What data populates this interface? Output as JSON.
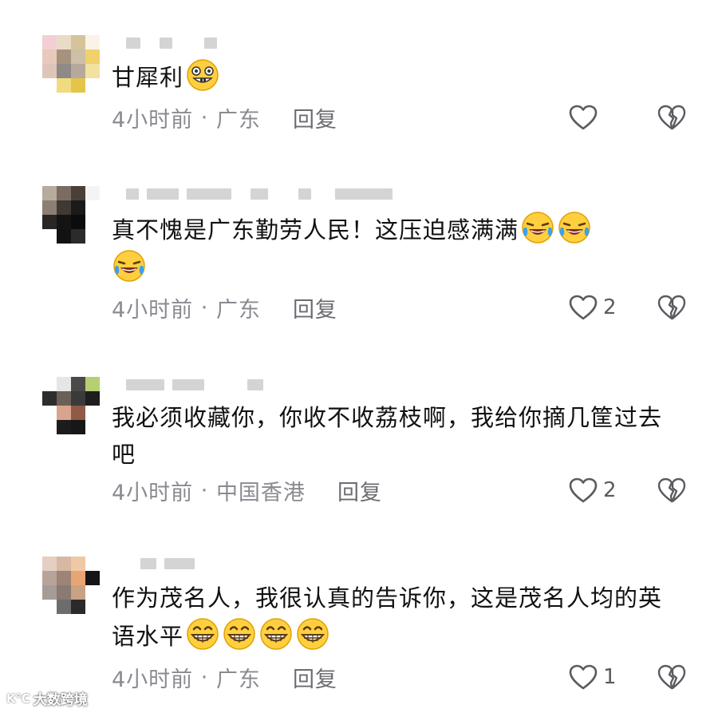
{
  "comments": [
    {
      "text": "甘犀利",
      "emojis": [
        "grin-face"
      ],
      "time": "4小时前",
      "location": "广东",
      "reply_label": "回复",
      "like_count": "",
      "avatar_colors": [
        "#f2cfd5",
        "#e9dcc6",
        "#d6c29b",
        "#fbf3e8",
        "#e8c9bb",
        "#a7927f",
        "#cdbfa8",
        "#f0d16b",
        "#dfc5b8",
        "#8f8a87",
        "#b6a89a",
        "#f3e1a0",
        "#ffffff",
        "#f0dc7e",
        "#e5c44a",
        "#ffffff"
      ]
    },
    {
      "text": "真不愧是广东勤劳人民！这压迫感满满",
      "emojis": [
        "laughing-crying-face",
        "laughing-crying-face",
        "laughing-crying-face"
      ],
      "time": "4小时前",
      "location": "广东",
      "reply_label": "回复",
      "like_count": "2",
      "avatar_colors": [
        "#b7ab9c",
        "#7a6c62",
        "#4b4038",
        "#f4f4f4",
        "#8c7f74",
        "#3f3833",
        "#1c1a19",
        "#ffffff",
        "#2a2624",
        "#141414",
        "#0c0c0c",
        "#ffffff",
        "#ffffff",
        "#121212",
        "#2b2b2b",
        "#ffffff"
      ]
    },
    {
      "text": "我必须收藏你，你收不收荔枝啊，我给你摘几筐过去吧",
      "emojis": [],
      "time": "4小时前",
      "location": "中国香港",
      "reply_label": "回复",
      "like_count": "2",
      "avatar_colors": [
        "#ffffff",
        "#e6e6e6",
        "#4a4a4a",
        "#b6cf72",
        "#2d2d2d",
        "#6b6056",
        "#3a3a3a",
        "#1e1e1e",
        "#ffffff",
        "#d8a48e",
        "#8f5a46",
        "#ffffff",
        "#ffffff",
        "#1c1c1c",
        "#171717",
        "#ffffff"
      ]
    },
    {
      "text": "作为茂名人，我很认真的告诉你，这是茂名人均的英语水平",
      "emojis": [
        "grin-face",
        "grin-face",
        "grin-face",
        "grin-face"
      ],
      "time": "4小时前",
      "location": "广东",
      "reply_label": "回复",
      "like_count": "1",
      "avatar_colors": [
        "#e4cfc2",
        "#d8b8a2",
        "#efc9a4",
        "#ffffff",
        "#b8a39a",
        "#9c8577",
        "#e8a574",
        "#151515",
        "#a59c98",
        "#8a7a71",
        "#c9a283",
        "#ffffff",
        "#ffffff",
        "#6d6d6d",
        "#2a2a2a",
        "#ffffff"
      ]
    }
  ],
  "watermark": {
    "logo": "K℃",
    "text": "大数跨境"
  },
  "colors": {
    "meta": "#8a8b91",
    "icon": "#5a5b60"
  }
}
